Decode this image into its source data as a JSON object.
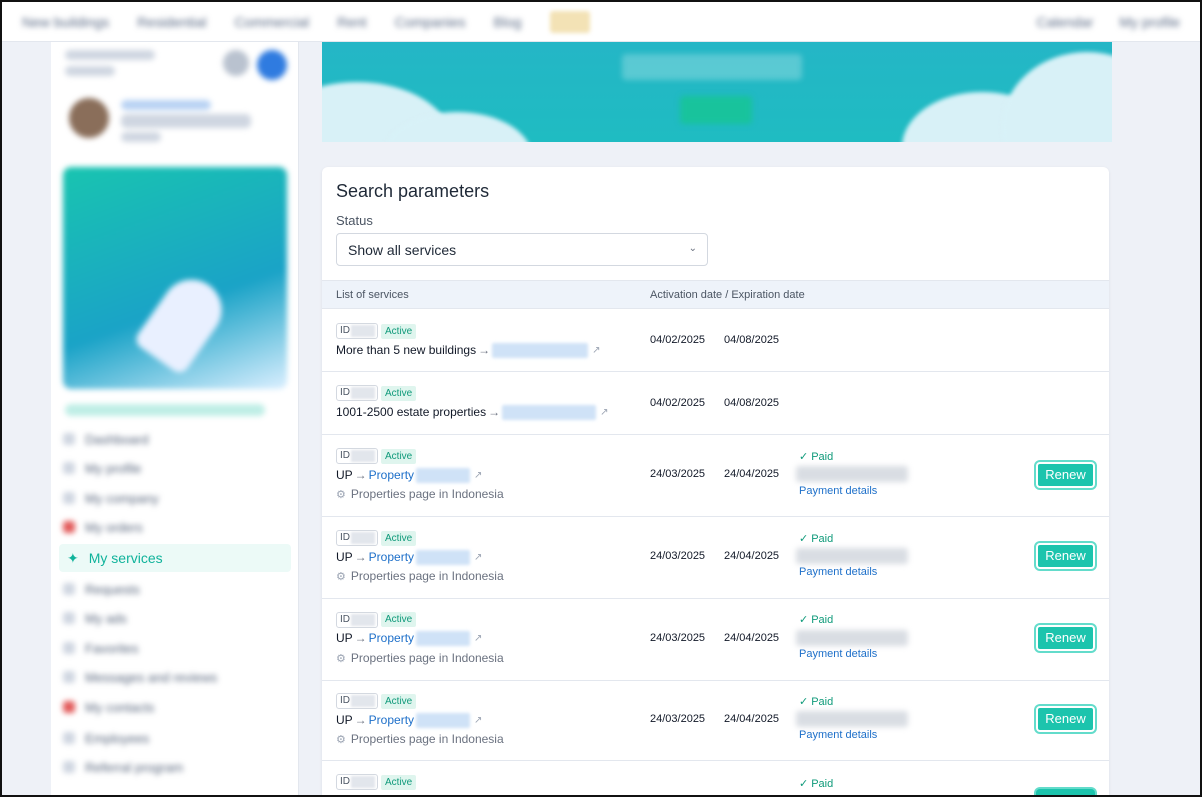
{
  "topnav": {
    "items": [
      "New buildings",
      "Residential",
      "Commercial",
      "Rent",
      "Companies",
      "Blog"
    ],
    "right_items": [
      "Calendar",
      "My profile"
    ]
  },
  "sidebar": {
    "menu": [
      {
        "label": "Dashboard"
      },
      {
        "label": "My profile"
      },
      {
        "label": "My company"
      },
      {
        "label": "My orders"
      }
    ],
    "active_item": {
      "label": "My services",
      "icon": "rocket-hand-icon"
    },
    "menu_after": [
      {
        "label": "Requests"
      },
      {
        "label": "My ads"
      },
      {
        "label": "Favorites"
      },
      {
        "label": "Messages and reviews"
      },
      {
        "label": "My contacts"
      },
      {
        "label": "Employees"
      },
      {
        "label": "Referral program"
      }
    ]
  },
  "search": {
    "title": "Search parameters",
    "status_label": "Status",
    "status_value": "Show all services"
  },
  "table": {
    "headers": [
      "List of services",
      "Activation date / Expiration date"
    ],
    "rows": [
      {
        "id_label": "ID",
        "status": "Active",
        "name": "More than 5 new buildings",
        "link": "",
        "sub": "",
        "activation": "04/02/2025",
        "expiration": "04/08/2025",
        "paid": "",
        "details": "",
        "renew": ""
      },
      {
        "id_label": "ID",
        "status": "Active",
        "name": "1001-2500 estate properties",
        "link": "",
        "sub": "",
        "activation": "04/02/2025",
        "expiration": "04/08/2025",
        "paid": "",
        "details": "",
        "renew": ""
      },
      {
        "id_label": "ID",
        "status": "Active",
        "name": "UP",
        "link": "Property",
        "sub": "Properties page in Indonesia",
        "activation": "24/03/2025",
        "expiration": "24/04/2025",
        "paid": "Paid",
        "details": "Payment details",
        "renew": "Renew"
      },
      {
        "id_label": "ID",
        "status": "Active",
        "name": "UP",
        "link": "Property",
        "sub": "Properties page in Indonesia",
        "activation": "24/03/2025",
        "expiration": "24/04/2025",
        "paid": "Paid",
        "details": "Payment details",
        "renew": "Renew"
      },
      {
        "id_label": "ID",
        "status": "Active",
        "name": "UP",
        "link": "Property",
        "sub": "Properties page in Indonesia",
        "activation": "24/03/2025",
        "expiration": "24/04/2025",
        "paid": "Paid",
        "details": "Payment details",
        "renew": "Renew"
      },
      {
        "id_label": "ID",
        "status": "Active",
        "name": "UP",
        "link": "Property",
        "sub": "Properties page in Indonesia",
        "activation": "24/03/2025",
        "expiration": "24/04/2025",
        "paid": "Paid",
        "details": "Payment details",
        "renew": "Renew"
      },
      {
        "id_label": "ID",
        "status": "Active",
        "name": "",
        "link": "",
        "sub": "",
        "activation": "",
        "expiration": "",
        "paid": "Paid",
        "details": "",
        "renew": ""
      }
    ]
  },
  "colors": {
    "accent": "#1cc4ad",
    "link": "#1d6fc9",
    "active_badge_bg": "#dff5ee"
  }
}
